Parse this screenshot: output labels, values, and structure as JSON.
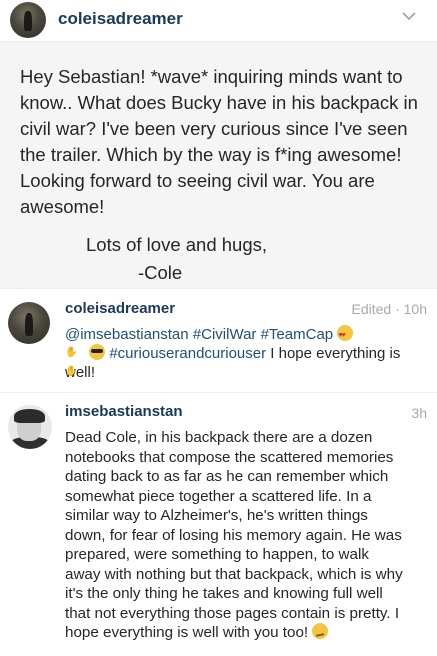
{
  "header": {
    "username": "coleisadreamer",
    "menu_icon": "chevron-down-icon"
  },
  "post": {
    "caption": "Hey Sebastian! *wave* inquiring minds want to know.. What does Bucky have in his backpack in civil war? I've been very curious since I've seen the trailer. Which by the way is f*ing awesome! Looking forward to seeing civil war. You are awesome!",
    "sign_line1": "Lots of love and hugs,",
    "sign_line2": "-Cole"
  },
  "comments": [
    {
      "username": "coleisadreamer",
      "meta": "Edited · 10h",
      "mention": "@imsebastianstan",
      "tag1": "#CivilWar",
      "tag2": "#TeamCap",
      "tag3": "#curiouserandcuriouser",
      "text_end": "I hope everything is well!",
      "emoji_icons": [
        "heart-eyes-emoji-icon",
        "raised-hands-emoji-icon",
        "sunglasses-emoji-icon"
      ]
    },
    {
      "username": "imsebastianstan",
      "meta": "3h",
      "text": "Dead Cole, in his backpack there are a dozen notebooks that compose the scattered memories dating back to as far as he can remember which somewhat piece together a scattered life. In a similar way to Alzheimer's, he's written things down, for fear of losing his memory again. He was prepared, were something to happen, to walk away with nothing but that backpack, which is why it's the only thing he takes and knowing full well that not everything those pages contain is pretty. I hope everything is well with you too!",
      "emoji_icon": "smirk-emoji-icon"
    }
  ],
  "colors": {
    "username": "#1a3a5c",
    "hashtag": "#1f4e79",
    "meta": "#a8a8a8",
    "post_background": "#f5f5f5"
  }
}
